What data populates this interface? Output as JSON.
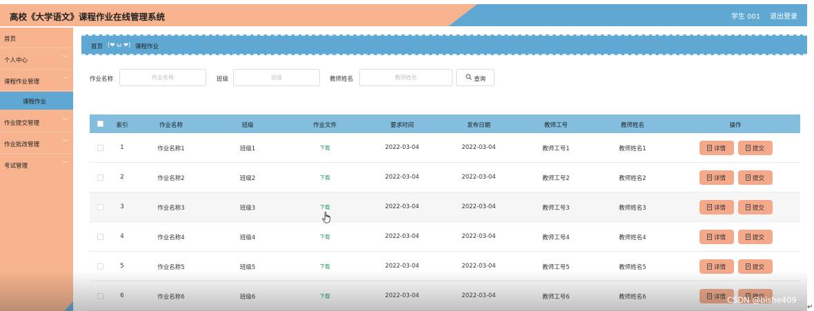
{
  "header": {
    "title": "高校《大学语文》课程作业在线管理系统",
    "user": "学生 001",
    "logout": "退出登录"
  },
  "sidebar": {
    "items": [
      {
        "label": "首页",
        "has_chevron": false
      },
      {
        "label": "个人中心",
        "has_chevron": true
      },
      {
        "label": "课程作业管理",
        "has_chevron": true
      },
      {
        "label": "作业提交管理",
        "has_chevron": true
      },
      {
        "label": "作业批改管理",
        "has_chevron": true
      },
      {
        "label": "考试管理",
        "has_chevron": true
      }
    ],
    "active_sub": "课程作业",
    "chevron": "chevron-down-icon"
  },
  "breadcrumb": {
    "home": "首页",
    "separator": "(❤ ω ❤)",
    "current": "课程作业"
  },
  "search": {
    "fields": [
      {
        "label": "作业名称",
        "placeholder": "作业名称"
      },
      {
        "label": "班级",
        "placeholder": "班级"
      },
      {
        "label": "教师姓名",
        "placeholder": "教师姓名"
      }
    ],
    "button": "查询",
    "button_icon": "search-icon"
  },
  "table": {
    "headers": [
      "索引",
      "作业名称",
      "班级",
      "作业文件",
      "要求时间",
      "发布日期",
      "教师工号",
      "教师姓名",
      "操作"
    ],
    "rows": [
      {
        "index": "1",
        "name": "作业名称1",
        "class": "班级1",
        "file": "下载",
        "due": "2022-03-04",
        "published": "2022-03-04",
        "teacher_id": "教师工号1",
        "teacher_name": "教师姓名1"
      },
      {
        "index": "2",
        "name": "作业名称2",
        "class": "班级2",
        "file": "下载",
        "due": "2022-03-04",
        "published": "2022-03-04",
        "teacher_id": "教师工号2",
        "teacher_name": "教师姓名2"
      },
      {
        "index": "3",
        "name": "作业名称3",
        "class": "班级3",
        "file": "下载",
        "due": "2022-03-04",
        "published": "2022-03-04",
        "teacher_id": "教师工号3",
        "teacher_name": "教师姓名3"
      },
      {
        "index": "4",
        "name": "作业名称4",
        "class": "班级4",
        "file": "下载",
        "due": "2022-03-04",
        "published": "2022-03-04",
        "teacher_id": "教师工号4",
        "teacher_name": "教师姓名4"
      },
      {
        "index": "5",
        "name": "作业名称5",
        "class": "班级5",
        "file": "下载",
        "due": "2022-03-04",
        "published": "2022-03-04",
        "teacher_id": "教师工号5",
        "teacher_name": "教师姓名5"
      },
      {
        "index": "6",
        "name": "作业名称6",
        "class": "班级6",
        "file": "下载",
        "due": "2022-03-04",
        "published": "2022-03-04",
        "teacher_id": "教师工号6",
        "teacher_name": "教师姓名6"
      }
    ],
    "actions": {
      "detail": "详情",
      "submit": "提交"
    },
    "action_icon": "document-icon"
  },
  "watermark": "CSDN @bishe409",
  "colors": {
    "peach": "#f8b48e",
    "blue": "#5fa8d3",
    "table_header": "#83bedf",
    "action_button": "#f4a98a",
    "download_link": "#2e9a68"
  }
}
